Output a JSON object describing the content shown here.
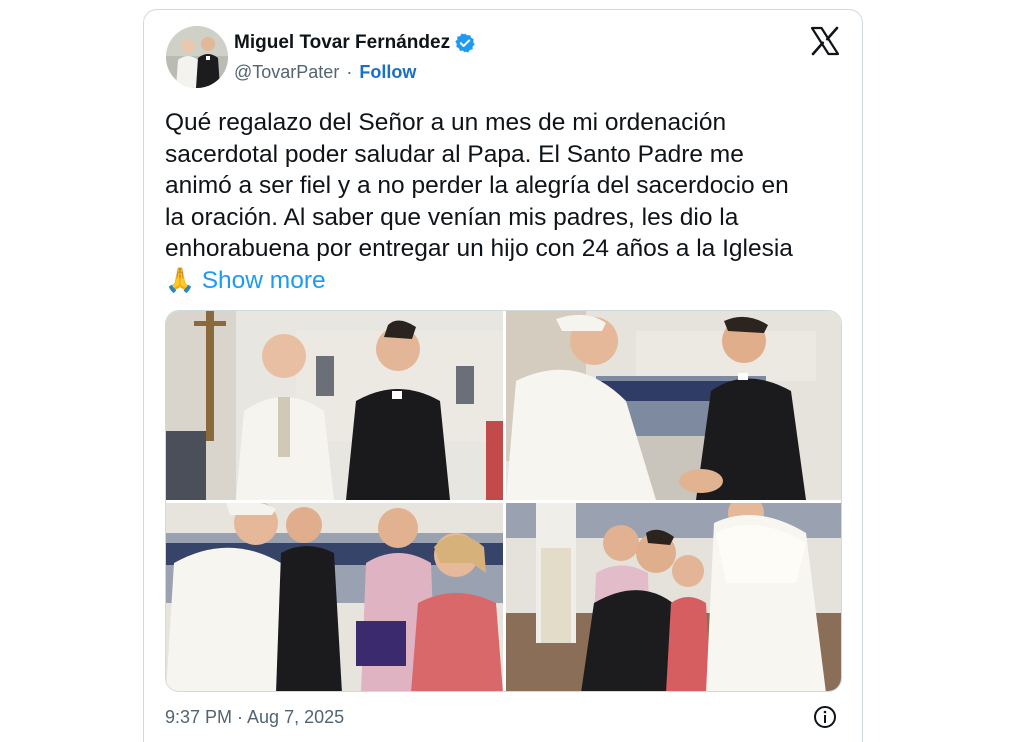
{
  "author": {
    "display_name": "Miguel Tovar Fernández",
    "handle": "@TovarPater",
    "separator": "·",
    "follow_label": "Follow",
    "verified_icon": "verified-badge-icon"
  },
  "brand_icon": "x-logo-icon",
  "tweet": {
    "text": "Qué regalazo del Señor a un mes de mi ordenación\nsacerdotal poder saludar al Papa. El Santo Padre me\nanimó a ser fiel y a no perder la alegría del sacerdocio en\nla oración. Al saber que venían mis padres, les dio la\nenhorabuena por entregar un hijo con 24 años a la Iglesia",
    "emoji": "🙏",
    "show_more_label": "Show more"
  },
  "media": {
    "photos": [
      {
        "name": "photo-pope-and-priest-portrait"
      },
      {
        "name": "photo-pope-greeting-priest"
      },
      {
        "name": "photo-pope-meeting-family"
      },
      {
        "name": "photo-family-kneeling-before-pope"
      }
    ]
  },
  "footer": {
    "timestamp": "9:37 PM · Aug 7, 2025",
    "info_icon": "info-icon"
  },
  "colors": {
    "link": "#1d9bf0",
    "verified": "#1d9bf0",
    "secondary_text": "#536471",
    "border": "#cfd9de"
  }
}
